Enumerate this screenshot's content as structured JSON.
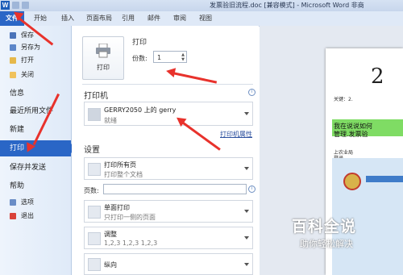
{
  "window": {
    "title": "发票验旧流程.doc [兼容模式] - Microsoft Word 非商"
  },
  "ribbon": {
    "tabs": [
      "文件",
      "开始",
      "插入",
      "页面布局",
      "引用",
      "邮件",
      "审阅",
      "视图"
    ]
  },
  "nav": {
    "save": "保存",
    "save_as": "另存为",
    "open": "打开",
    "close": "关闭",
    "info": "信息",
    "recent": "最近所用文件",
    "new": "新建",
    "print": "打印",
    "save_send": "保存并发送",
    "help": "帮助",
    "options": "选项",
    "exit": "退出"
  },
  "print": {
    "section_title": "打印",
    "button_label": "打印",
    "copies_label": "份数:",
    "copies_value": "1"
  },
  "printer": {
    "section_title": "打印机",
    "name": "GERRY2050 上的 gerry",
    "status": "就绪",
    "properties_link": "打印机属性"
  },
  "settings": {
    "section_title": "设置",
    "range_main": "打印所有页",
    "range_sub": "打印整个文档",
    "pages_label": "页数:",
    "sides_main": "单面打印",
    "sides_sub": "只打印一侧的页面",
    "collate_main": "调整",
    "collate_sub": "1,2,3    1,2,3    1,2,3",
    "orientation_main": "纵向"
  },
  "preview": {
    "big_char": "2",
    "line1": "关键：2.",
    "green_line1": "我在说说如何",
    "green_line2": "管理.发票验",
    "line2": "上农业局",
    "line3": "登录"
  },
  "watermark": {
    "title": "百科全说",
    "subtitle": "助你轻松解决"
  },
  "colors": {
    "accent": "#2a66c6",
    "arrow": "#e8322c",
    "highlight": "#7fdc64"
  }
}
